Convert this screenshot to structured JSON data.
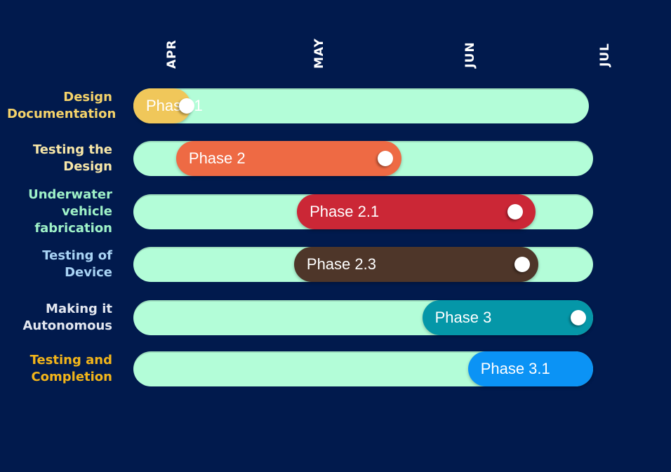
{
  "chart_data": {
    "type": "gantt",
    "months": [
      "APR",
      "MAY",
      "JUN",
      "JUL"
    ],
    "tasks": [
      {
        "label": [
          "Design",
          "Documentation"
        ],
        "phase": "Phase 1",
        "start": 0.0,
        "end": 0.39,
        "progress": 0.36,
        "color": "#f0c75a",
        "label_color": "#f5d36a",
        "track_end": 3.09
      },
      {
        "label": [
          "Testing the",
          "Design"
        ],
        "phase": "Phase 2",
        "start": 0.29,
        "end": 1.82,
        "progress": 1.71,
        "color": "#ee6a44",
        "label_color": "#f8e7a8",
        "track_end": 3.12
      },
      {
        "label": [
          "Underwater",
          "vehicle",
          "fabrication"
        ],
        "phase": "Phase 2.1",
        "start": 1.11,
        "end": 2.73,
        "progress": 2.59,
        "color": "#cb2736",
        "label_color": "#9ff2c8",
        "track_end": 3.12
      },
      {
        "label": [
          "Testing of",
          "Device"
        ],
        "phase": "Phase 2.3",
        "start": 1.09,
        "end": 2.75,
        "progress": 2.64,
        "color": "#4e3629",
        "label_color": "#a9d4f5",
        "track_end": 3.12
      },
      {
        "label": [
          "Making it",
          "Autonomous"
        ],
        "phase": "Phase 3",
        "start": 1.96,
        "end": 3.12,
        "progress": 3.02,
        "color": "#0597a8",
        "label_color": "#e3e7f0",
        "track_end": 3.12
      },
      {
        "label": [
          "Testing and",
          "Completion"
        ],
        "phase": "Phase 3.1",
        "start": 2.27,
        "end": 3.12,
        "progress": null,
        "color": "#0b93f5",
        "label_color": "#f2b51a",
        "track_end": 3.12
      }
    ]
  }
}
